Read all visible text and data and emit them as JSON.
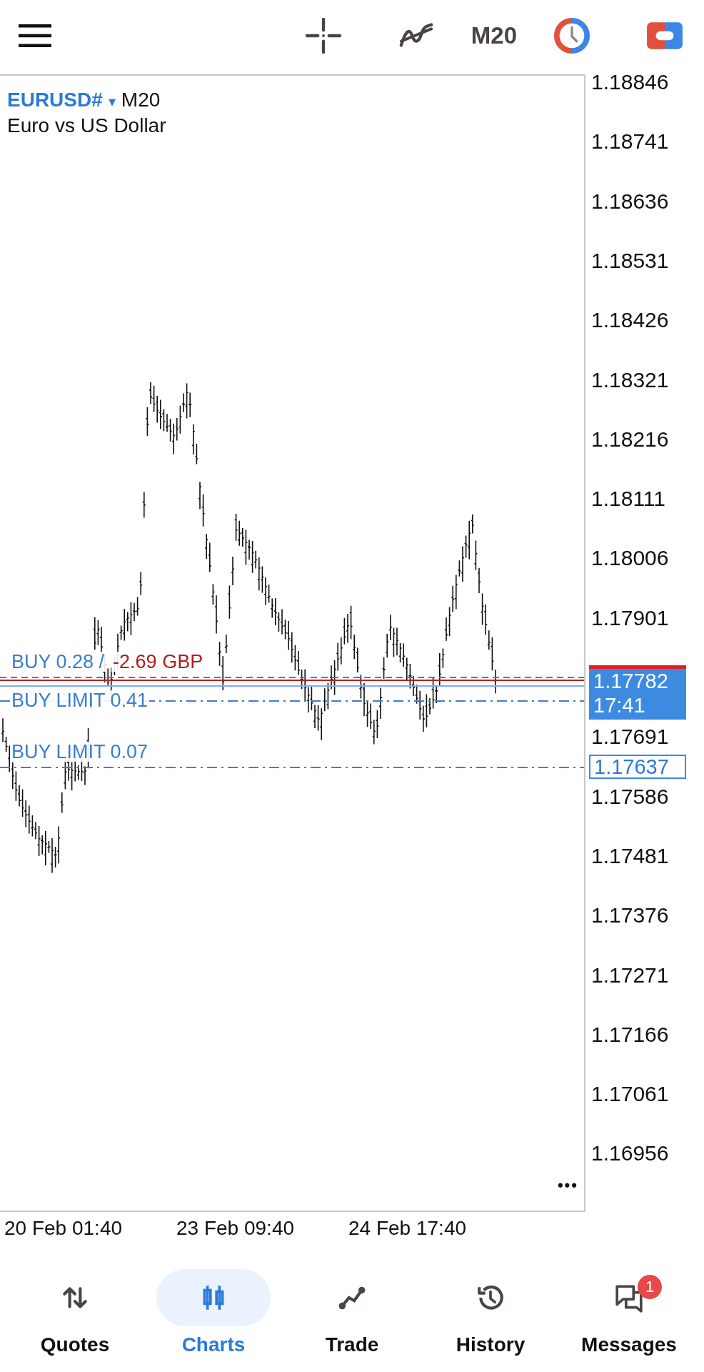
{
  "toolbar": {
    "timeframe": "M20"
  },
  "chart": {
    "symbol": "EURUSD#",
    "dropdown_glyph": "▾",
    "timeframe": "M20",
    "description": "Euro vs US Dollar",
    "orders": [
      {
        "kind": "position",
        "label": "BUY 0.28 /",
        "profit": "-2.69 GBP"
      },
      {
        "kind": "limit",
        "label": "BUY LIMIT 0.41"
      },
      {
        "kind": "limit",
        "label": "BUY LIMIT 0.07"
      }
    ],
    "price_axis": [
      "1.18846",
      "1.18741",
      "1.18636",
      "1.18531",
      "1.18426",
      "1.18321",
      "1.18216",
      "1.18111",
      "1.18006",
      "1.17901",
      "1.17691",
      "1.17586",
      "1.17481",
      "1.17376",
      "1.17271",
      "1.17166",
      "1.17061",
      "1.16956"
    ],
    "current_price": {
      "price": "1.17782",
      "time": "17:41"
    },
    "limit_price_tag": "1.17637",
    "time_axis": [
      "20 Feb 01:40",
      "23 Feb 09:40",
      "24 Feb 17:40"
    ],
    "more": "•••"
  },
  "nav": [
    {
      "label": "Quotes",
      "kind": "quotes",
      "selected": false
    },
    {
      "label": "Charts",
      "kind": "charts",
      "selected": true
    },
    {
      "label": "Trade",
      "kind": "trade",
      "selected": false
    },
    {
      "label": "History",
      "kind": "history",
      "selected": false
    },
    {
      "label": "Messages",
      "kind": "messages",
      "selected": false,
      "badge": "1"
    }
  ]
}
